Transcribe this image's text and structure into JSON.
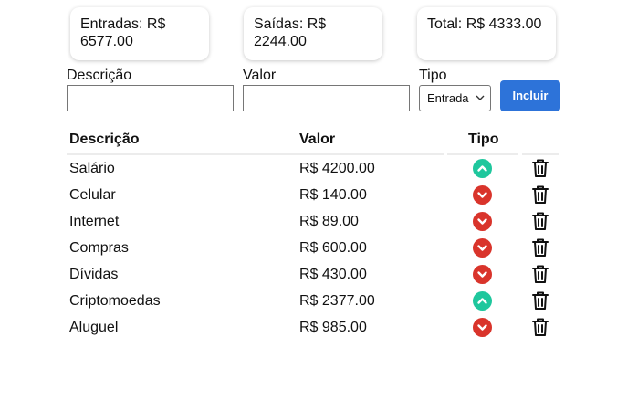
{
  "summary": {
    "entradas": "Entradas: R$ 6577.00",
    "saidas": "Saídas: R$ 2244.00",
    "total": "Total: R$ 4333.00"
  },
  "form": {
    "descricao_label": "Descrição",
    "descricao_value": "",
    "valor_label": "Valor",
    "valor_value": "",
    "tipo_label": "Tipo",
    "tipo_selected": "Entrada",
    "submit_label": "Incluir"
  },
  "table": {
    "headers": {
      "descricao": "Descrição",
      "valor": "Valor",
      "tipo": "Tipo"
    },
    "rows": [
      {
        "descricao": "Salário",
        "valor": "R$ 4200.00",
        "tipo": "entrada"
      },
      {
        "descricao": "Celular",
        "valor": "R$ 140.00",
        "tipo": "saida"
      },
      {
        "descricao": "Internet",
        "valor": "R$ 89.00",
        "tipo": "saida"
      },
      {
        "descricao": "Compras",
        "valor": "R$ 600.00",
        "tipo": "saida"
      },
      {
        "descricao": "Dívidas",
        "valor": "R$ 430.00",
        "tipo": "saida"
      },
      {
        "descricao": "Criptomoedas",
        "valor": "R$ 2377.00",
        "tipo": "entrada"
      },
      {
        "descricao": "Aluguel",
        "valor": "R$ 985.00",
        "tipo": "saida"
      }
    ]
  },
  "icons": {
    "entrada": "chevron-up-circle-icon",
    "saida": "chevron-down-circle-icon",
    "delete": "trash-icon"
  },
  "colors": {
    "entrada": "#1fc79d",
    "saida": "#d9342b",
    "accent": "#2d73d9"
  }
}
